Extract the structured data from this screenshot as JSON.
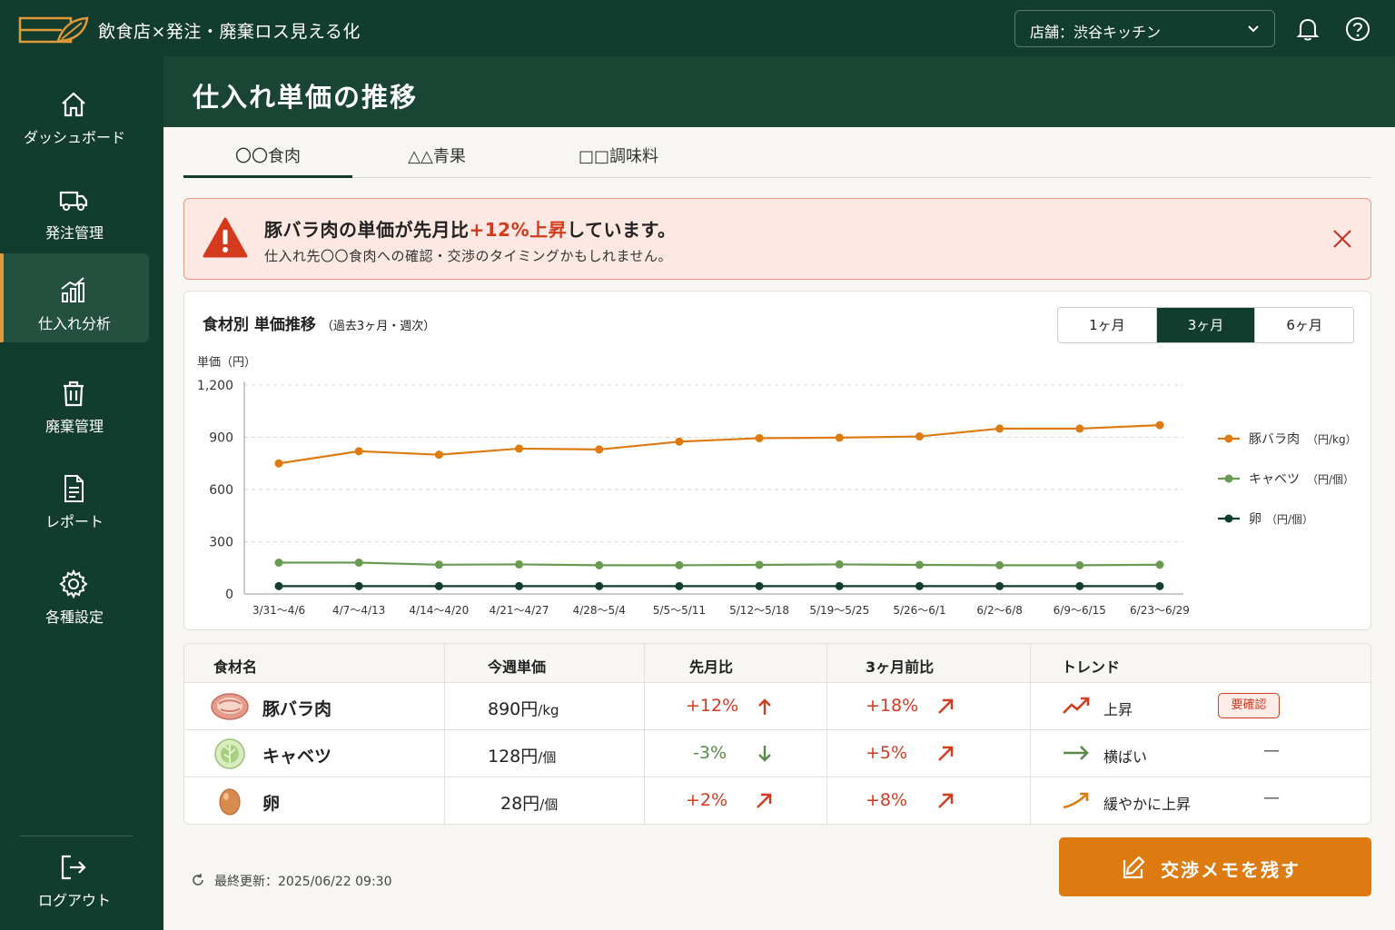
{
  "app": {
    "title": "飲食店×発注・廃棄ロス見える化"
  },
  "header": {
    "store_label": "店舗：渋谷キッチン"
  },
  "sidebar": {
    "items": [
      {
        "label": "ダッシュボード",
        "icon": "home-icon"
      },
      {
        "label": "発注管理",
        "icon": "truck-icon"
      },
      {
        "label": "仕入れ分析",
        "icon": "chart-icon",
        "active": true
      },
      {
        "label": "廃棄管理",
        "icon": "trash-icon"
      },
      {
        "label": "レポート",
        "icon": "document-icon"
      },
      {
        "label": "各種設定",
        "icon": "gear-icon"
      }
    ],
    "logout": "ログアウト"
  },
  "page": {
    "title": "仕入れ単価の推移"
  },
  "tabs": [
    "〇〇食肉",
    "△△青果",
    "□□調味料"
  ],
  "alert": {
    "title_pre": "豚バラ肉の単価が先月比",
    "title_highlight": "+12%上昇",
    "title_post": "しています。",
    "message": "仕入れ先〇〇食肉への確認・交渉のタイミングかもしれません。"
  },
  "chart_card": {
    "title": "食材別 単価推移",
    "subtitle": "（過去3ヶ月・週次）",
    "ranges": [
      "1ヶ月",
      "3ヶ月",
      "6ヶ月"
    ],
    "active_range": "3ヶ月"
  },
  "chart_data": {
    "type": "line",
    "ylabel": "単価（円）",
    "ylim": [
      0,
      1200
    ],
    "yticks": [
      "0",
      "300",
      "600",
      "900",
      "1,200"
    ],
    "grid": true,
    "legend_position": "right",
    "categories": [
      "3/31〜4/6",
      "4/7〜4/13",
      "4/14〜4/20",
      "4/21〜4/27",
      "4/28〜5/4",
      "5/5〜5/11",
      "5/12〜5/18",
      "5/19〜5/25",
      "5/26〜6/1",
      "6/2〜6/8",
      "6/9〜6/15",
      "6/23〜6/29"
    ],
    "series": [
      {
        "name": "豚バラ肉",
        "unit": "（円/kg）",
        "color": "#dd7a10",
        "values": [
          750,
          820,
          800,
          835,
          830,
          875,
          895,
          898,
          905,
          950,
          950,
          970
        ]
      },
      {
        "name": "キャベツ",
        "unit": "（円/個）",
        "color": "#6a9a52",
        "values": [
          180,
          180,
          168,
          170,
          165,
          165,
          167,
          170,
          167,
          165,
          165,
          168
        ]
      },
      {
        "name": "卵",
        "unit": "（円/個）",
        "color": "#123c2d",
        "values": [
          45,
          45,
          45,
          45,
          45,
          45,
          45,
          45,
          45,
          45,
          45,
          45
        ]
      }
    ]
  },
  "table": {
    "headers": [
      "食材名",
      "今週単価",
      "先月比",
      "3ヶ月前比",
      "トレンド"
    ],
    "rows": [
      {
        "name": "豚バラ肉",
        "price": "890円",
        "unit": "/kg",
        "mom": "+12%",
        "q3": "+18%",
        "trend": "上昇",
        "badge": "要確認"
      },
      {
        "name": "キャベツ",
        "price": "128円",
        "unit": "/個",
        "mom": "-3%",
        "q3": "+5%",
        "trend": "横ばい",
        "dash": "—"
      },
      {
        "name": "卵",
        "price": "28円",
        "unit": "/個",
        "mom": "+2%",
        "q3": "+8%",
        "trend": "緩やかに上昇",
        "dash": "—"
      }
    ]
  },
  "footer": {
    "updated": "最終更新：2025/06/22 09:30",
    "memo_button": "交渉メモを残す"
  }
}
